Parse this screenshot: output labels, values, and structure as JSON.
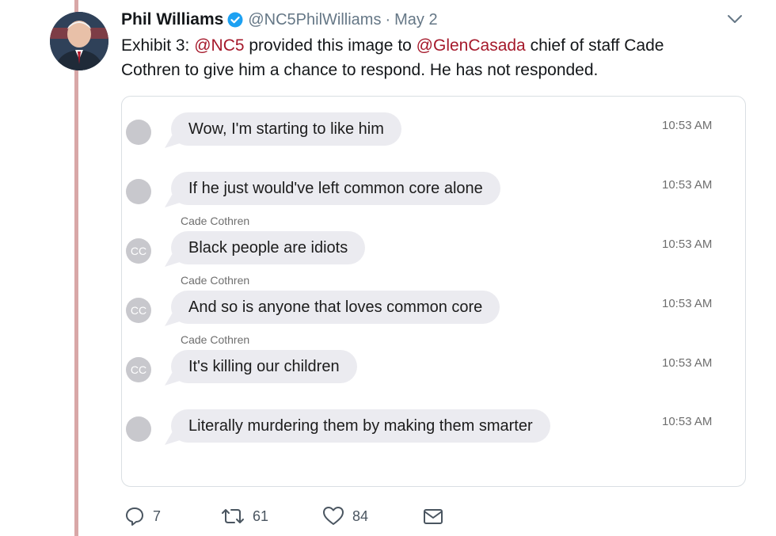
{
  "tweet": {
    "author_name": "Phil Williams",
    "handle": "@NC5PhilWilliams",
    "separator": "·",
    "date": "May 2",
    "text_parts": [
      "Exhibit 3: ",
      "@NC5",
      " provided this image to ",
      "@GlenCasada",
      " chief of staff Cade Cothren to give him a chance to respond. He has not responded."
    ],
    "icons": {
      "verified": "verified-badge-icon",
      "menu": "chevron-down-icon"
    },
    "colors": {
      "mention": "#a5192b",
      "verified": "#1da1f2",
      "thread_line": "#d8a7a7"
    }
  },
  "messages": [
    {
      "sender": "",
      "avatar_initials": "",
      "text": "Wow, I'm starting to like him",
      "time": "10:53 AM"
    },
    {
      "sender": "",
      "avatar_initials": "",
      "text": "If he just would've left common core alone",
      "time": "10:53 AM"
    },
    {
      "sender": "Cade Cothren",
      "avatar_initials": "CC",
      "text": "Black people are idiots",
      "time": "10:53 AM"
    },
    {
      "sender": "Cade Cothren",
      "avatar_initials": "CC",
      "text": "And so is anyone that loves common core",
      "time": "10:53 AM"
    },
    {
      "sender": "Cade Cothren",
      "avatar_initials": "CC",
      "text": "It's killing our children",
      "time": "10:53 AM"
    },
    {
      "sender": "",
      "avatar_initials": "",
      "text": "Literally murdering them by making them smarter",
      "time": "10:53 AM"
    }
  ],
  "actions": {
    "reply": {
      "icon": "reply-icon",
      "count": "7"
    },
    "retweet": {
      "icon": "retweet-icon",
      "count": "61"
    },
    "like": {
      "icon": "heart-icon",
      "count": "84"
    },
    "message": {
      "icon": "envelope-icon"
    }
  }
}
